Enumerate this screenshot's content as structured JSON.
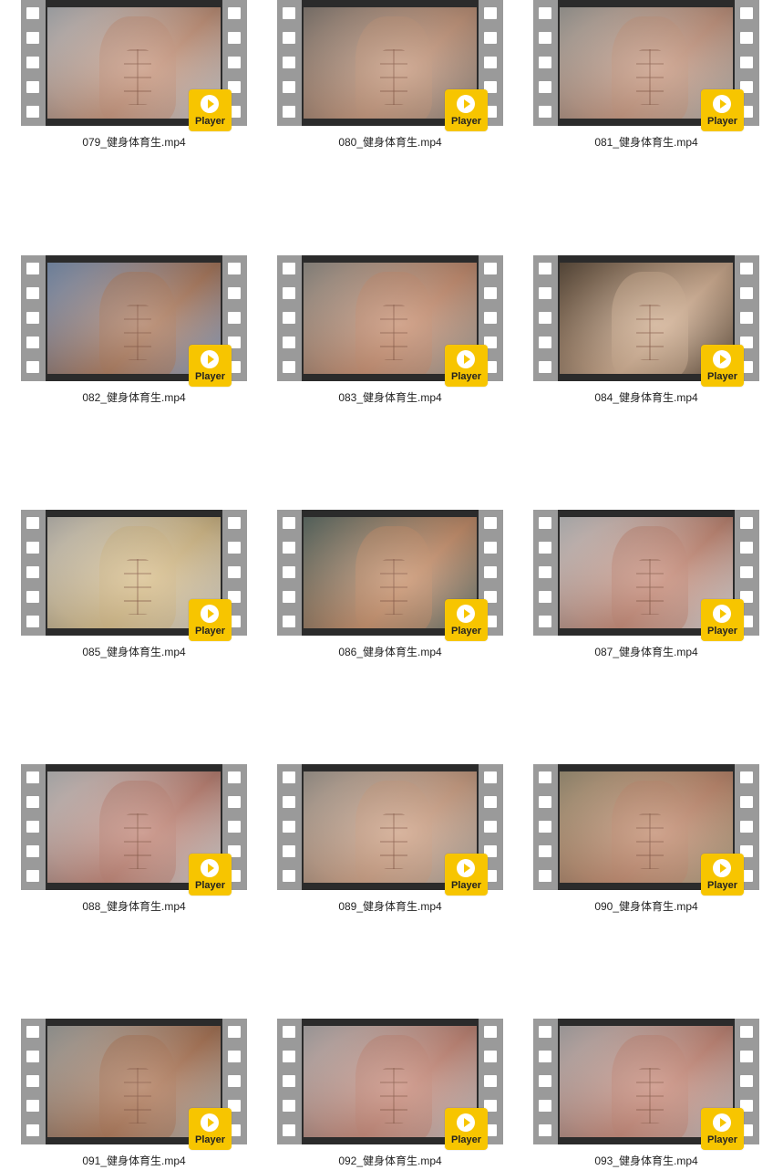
{
  "player_badge_label": "Player",
  "badge_color": "#f7c500",
  "film_strip_color": "#9a9a9a",
  "files": [
    {
      "name": "079_健身体育生.mp4",
      "colors": [
        "#c9ccd0",
        "#c8987f"
      ]
    },
    {
      "name": "080_健身体育生.mp4",
      "colors": [
        "#9a8f86",
        "#c79a80"
      ]
    },
    {
      "name": "081_健身体育生.mp4",
      "colors": [
        "#b9b6b0",
        "#c89a84"
      ]
    },
    {
      "name": "082_健身体育生.mp4",
      "colors": [
        "#8fa7c9",
        "#b07f63"
      ]
    },
    {
      "name": "083_健身体育生.mp4",
      "colors": [
        "#a9a49c",
        "#c99275"
      ]
    },
    {
      "name": "084_健身体育生.mp4",
      "colors": [
        "#6c5a48",
        "#d2b094"
      ]
    },
    {
      "name": "085_健身体育生.mp4",
      "colors": [
        "#d8d4cc",
        "#d9c08e"
      ]
    },
    {
      "name": "086_健身体育生.mp4",
      "colors": [
        "#6e7e76",
        "#c99370"
      ]
    },
    {
      "name": "087_健身体育生.mp4",
      "colors": [
        "#d9d9da",
        "#c78d7a"
      ]
    },
    {
      "name": "088_健身体育生.mp4",
      "colors": [
        "#d6d6d6",
        "#c3887a"
      ]
    },
    {
      "name": "089_健身体育生.mp4",
      "colors": [
        "#b9b0a6",
        "#d0a489"
      ]
    },
    {
      "name": "090_健身体育生.mp4",
      "colors": [
        "#b7a88a",
        "#c58f74"
      ]
    },
    {
      "name": "091_健身体育生.mp4",
      "colors": [
        "#b8b9b5",
        "#b07b5c"
      ]
    },
    {
      "name": "092_健身体育生.mp4",
      "colors": [
        "#c9c4c4",
        "#c88c7c"
      ]
    },
    {
      "name": "093_健身体育生.mp4",
      "colors": [
        "#c9c4c4",
        "#c88c7c"
      ]
    }
  ]
}
